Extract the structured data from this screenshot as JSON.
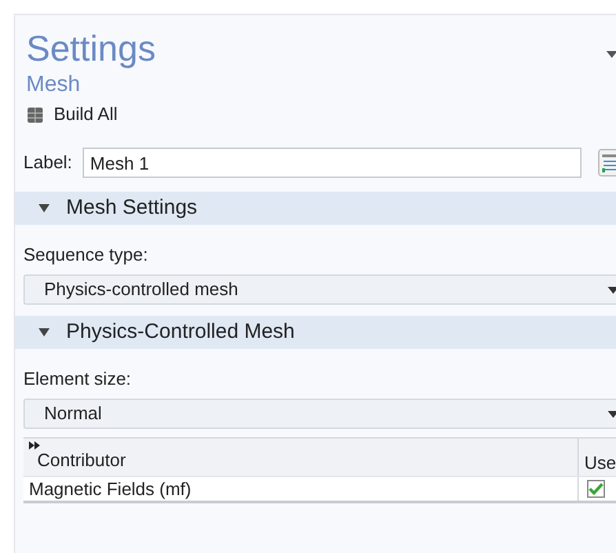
{
  "title": "Settings",
  "node": "Mesh",
  "toolbar": [
    {
      "label": "Build All"
    }
  ],
  "label_field": {
    "label": "Label:",
    "value": "Mesh 1"
  },
  "sections": [
    {
      "title": "Mesh Settings",
      "expanded": true,
      "field_label": "Sequence type:",
      "value": "Physics-controlled mesh"
    },
    {
      "title": "Physics-Controlled Mesh",
      "expanded": true,
      "field_label": "Element size:",
      "value": "Normal",
      "table": {
        "columns": [
          "Contributor",
          "Use"
        ],
        "rows": [
          {
            "contributor": "Magnetic Fields (mf)",
            "checked": true
          }
        ]
      }
    }
  ]
}
